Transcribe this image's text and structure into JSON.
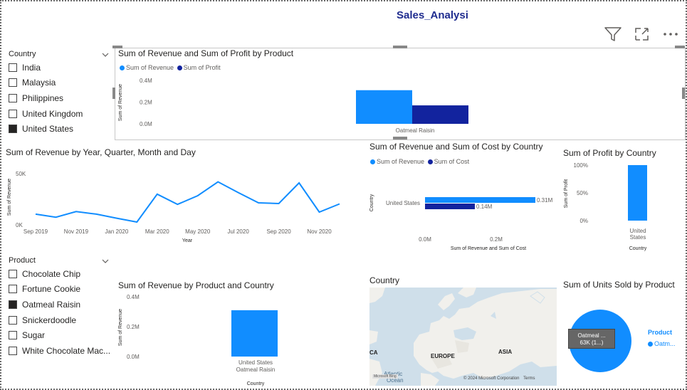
{
  "report": {
    "title": "Sales_Analysi"
  },
  "colors": {
    "revenue": "#118DFF",
    "profit": "#12239E",
    "title": "#1F2C8F"
  },
  "header_icons": [
    "filter-icon",
    "focus-mode-icon",
    "more-options-icon"
  ],
  "country_slicer": {
    "header": "Country",
    "items": [
      {
        "label": "India",
        "checked": false
      },
      {
        "label": "Malaysia",
        "checked": false
      },
      {
        "label": "Philippines",
        "checked": false
      },
      {
        "label": "United Kingdom",
        "checked": false
      },
      {
        "label": "United States",
        "checked": true
      }
    ]
  },
  "product_slicer": {
    "header": "Product",
    "items": [
      {
        "label": "Chocolate Chip",
        "checked": false
      },
      {
        "label": "Fortune Cookie",
        "checked": false
      },
      {
        "label": "Oatmeal Raisin",
        "checked": true
      },
      {
        "label": "Snickerdoodle",
        "checked": false
      },
      {
        "label": "Sugar",
        "checked": false
      },
      {
        "label": "White Chocolate Mac...",
        "checked": false
      }
    ]
  },
  "map": {
    "title": "Country",
    "labels": {
      "europe": "EUROPE",
      "asia": "ASIA",
      "ca": "CA",
      "atlantic": "Atlantic",
      "ocean": "Ocean"
    },
    "copyright": "© 2024 Microsoft Corporation",
    "terms": "Terms",
    "logo": "Microsoft Bing"
  },
  "chart_data": [
    {
      "type": "bar",
      "title": "Sum of Revenue and Sum of Profit by Product",
      "categories": [
        "Oatmeal Raisin"
      ],
      "series": [
        {
          "name": "Sum of Revenue",
          "values": [
            0.31
          ]
        },
        {
          "name": "Sum of Profit",
          "values": [
            0.17
          ]
        }
      ],
      "ylabel": "Sum of Revenue",
      "yticks": [
        "0.4M",
        "0.2M",
        "0.0M"
      ],
      "ylim": [
        0,
        0.4
      ]
    },
    {
      "type": "line",
      "title": "Sum of Revenue by Year, Quarter, Month and Day",
      "xlabel": "Year",
      "ylabel": "Sum of Revenue",
      "x": [
        "2019-09",
        "2019-10",
        "2019-11",
        "2019-12",
        "2020-01",
        "2020-02",
        "2020-03",
        "2020-04",
        "2020-05",
        "2020-06",
        "2020-07",
        "2020-08",
        "2020-09",
        "2020-10",
        "2020-11",
        "2020-12"
      ],
      "series": [
        {
          "name": "Sum of Revenue",
          "values": [
            10500,
            7500,
            13000,
            10500,
            6500,
            2800,
            30000,
            20000,
            28500,
            42000,
            31500,
            21500,
            20800,
            41000,
            12500,
            20500
          ]
        }
      ],
      "xticks": [
        "Sep 2019",
        "Nov 2019",
        "Jan 2020",
        "Mar 2020",
        "May 2020",
        "Jul 2020",
        "Sep 2020",
        "Nov 2020"
      ],
      "yticks": [
        "50K",
        "0K"
      ],
      "ylim": [
        0,
        50000
      ]
    },
    {
      "type": "bar",
      "orientation": "horizontal",
      "title": "Sum of Revenue and Sum of Cost by Country",
      "categories": [
        "United States"
      ],
      "series": [
        {
          "name": "Sum of Revenue",
          "values": [
            0.31
          ]
        },
        {
          "name": "Sum of Cost",
          "values": [
            0.14
          ]
        }
      ],
      "data_labels": [
        "0.31M",
        "0.14M"
      ],
      "xlabel": "Sum of Revenue and Sum of Cost",
      "ylabel": "Country",
      "xticks": [
        "0.0M",
        "0.2M"
      ],
      "xlim": [
        0,
        0.31
      ]
    },
    {
      "type": "bar",
      "title": "Sum of Profit by Country",
      "categories": [
        "United States"
      ],
      "category_lines": [
        "United",
        "States"
      ],
      "series": [
        {
          "name": "Sum of Profit",
          "values": [
            100
          ]
        }
      ],
      "xlabel": "Country",
      "ylabel": "Sum of Profit",
      "yticks": [
        "100%",
        "50%",
        "0%"
      ],
      "ylim": [
        0,
        100
      ]
    },
    {
      "type": "bar",
      "title": "Sum of Revenue by Product and Country",
      "categories": [
        "United States Oatmeal Raisin"
      ],
      "category_lines": [
        "United States",
        "Oatmeal Raisin"
      ],
      "series": [
        {
          "name": "Sum of Revenue",
          "values": [
            0.31
          ]
        }
      ],
      "xlabel": "Country",
      "ylabel": "Sum of Revenue",
      "yticks": [
        "0.4M",
        "0.2M",
        "0.0M"
      ],
      "ylim": [
        0,
        0.4
      ]
    },
    {
      "type": "pie",
      "title": "Sum of Units Sold by Product",
      "slices": [
        {
          "label": "Oatmeal Raisin",
          "value": 63
        }
      ],
      "tooltip_lines": [
        "Oatmeal ...",
        "63K (1...)"
      ],
      "legend_title": "Product",
      "legend_items": [
        "Oatm..."
      ]
    }
  ]
}
